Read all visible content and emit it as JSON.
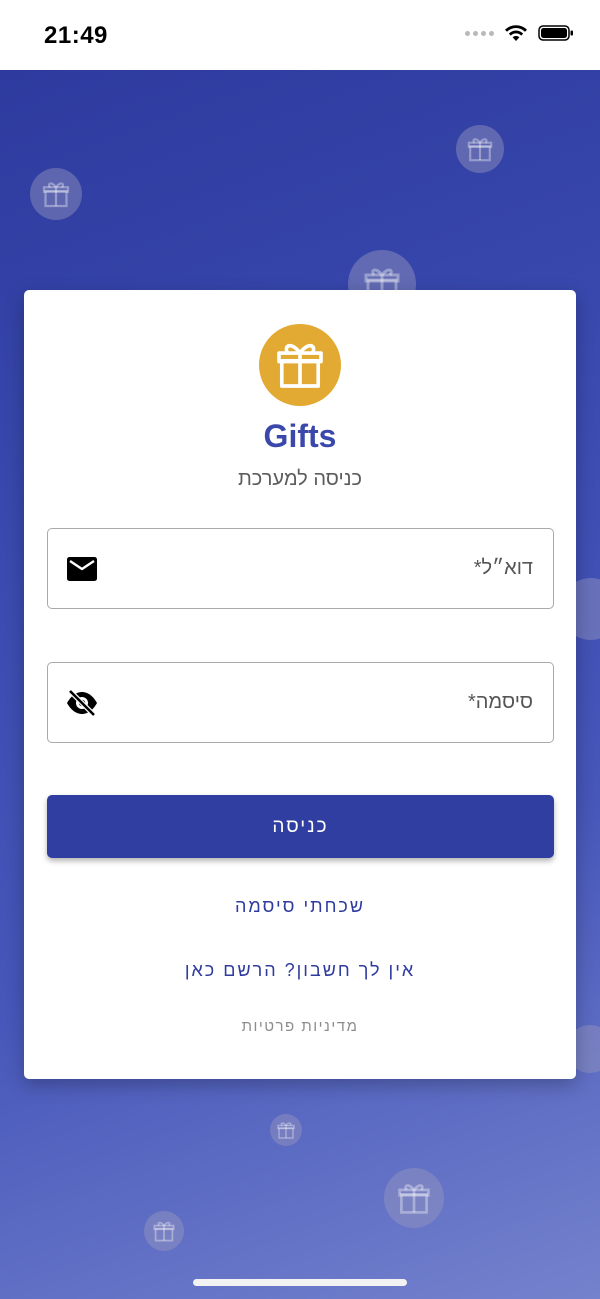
{
  "status_bar": {
    "time": "21:49"
  },
  "app": {
    "name": "Gifts",
    "subtitle": "כניסה למערכת"
  },
  "form": {
    "email_placeholder": "דוא״ל*",
    "password_placeholder": "סיסמה*",
    "login_label": "כניסה"
  },
  "links": {
    "forgot_password": "שכחתי סיסמה",
    "register": "אין לך חשבון? הרשם כאן",
    "privacy": "מדיניות פרטיות"
  },
  "icons": {
    "logo": "gift-icon",
    "email": "mail-icon",
    "password_toggle": "eye-off-icon"
  },
  "colors": {
    "primary": "#2f3ea0",
    "brand_text": "#3a48ab",
    "logo_gold": "#e2aa32"
  }
}
